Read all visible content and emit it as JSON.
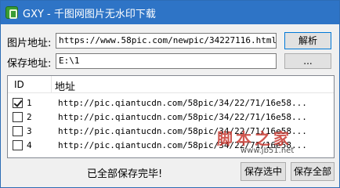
{
  "window": {
    "title": "GXY - 千图网图片无水印下载"
  },
  "form": {
    "url_label": "图片地址:",
    "url_value": "https://www.58pic.com/newpic/34227116.html",
    "parse_button": "解析",
    "path_label": "保存地址:",
    "path_value": "E:\\1",
    "browse_button": "..."
  },
  "list": {
    "headers": {
      "id": "ID",
      "url": "地址"
    },
    "rows": [
      {
        "id": "1",
        "url": "http://pic.qiantucdn.com/58pic/34/22/71/16e58...",
        "checked": true
      },
      {
        "id": "2",
        "url": "http://pic.qiantucdn.com/58pic/34/22/71/16e58...",
        "checked": false
      },
      {
        "id": "3",
        "url": "http://pic.qiantucdn.com/58pic/34/22/71/16e58...",
        "checked": false
      },
      {
        "id": "4",
        "url": "http://pic.qiantucdn.com/58pic/34/22/71/16e58...",
        "checked": false
      }
    ]
  },
  "footer": {
    "status": "已全部保存完毕!",
    "save_selected_button": "保存选中",
    "save_all_button": "保存全部"
  },
  "watermark": {
    "main": "脚本之家",
    "sub": "www.jb51.net"
  },
  "colors": {
    "titlebar": "#2e74c6",
    "accent": "#0078d7",
    "watermark": "#c83a32"
  }
}
